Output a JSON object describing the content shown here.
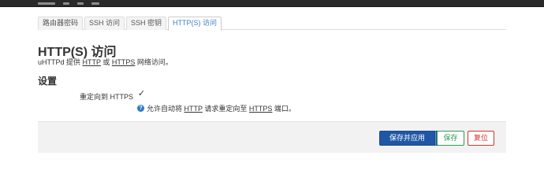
{
  "tabs": [
    {
      "label": "路由器密码",
      "active": false
    },
    {
      "label": "SSH 访问",
      "active": false
    },
    {
      "label": "SSH 密钥",
      "active": false
    },
    {
      "label": "HTTP(S) 访问",
      "active": true
    }
  ],
  "page": {
    "title": "HTTP(S) 访问",
    "desc_prefix": "uHTTPd 提供 ",
    "desc_http": "HTTP",
    "desc_or": " 或 ",
    "desc_https": "HTTPS",
    "desc_suffix": " 网络访问。"
  },
  "section": {
    "title": "设置"
  },
  "field": {
    "label": "重定向到 HTTPS",
    "checked": true,
    "check_glyph": "✓",
    "help_icon_glyph": "?",
    "help_prefix": "允许自动将 ",
    "help_http": "HTTP",
    "help_mid": " 请求重定向至 ",
    "help_https": "HTTPS",
    "help_suffix": " 端口。"
  },
  "actions": {
    "apply_label": "保存并应用",
    "dropdown_glyph": "▾",
    "save_label": "保存",
    "reset_label": "复位"
  },
  "colors": {
    "apply": "#1f57a6",
    "save": "#2e9a55",
    "reset": "#d2322d",
    "active_tab": "#3a7ec4",
    "help_icon": "#2f7ac6"
  }
}
